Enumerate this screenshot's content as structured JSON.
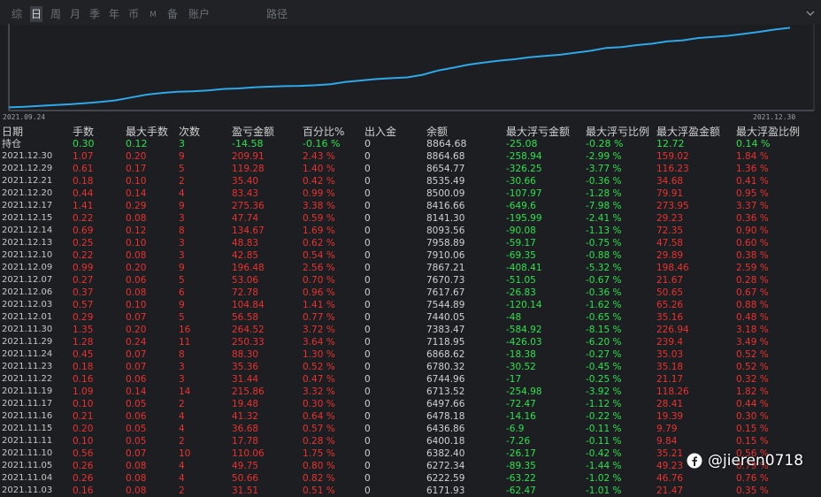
{
  "tabs": [
    {
      "label": "综",
      "active": false
    },
    {
      "label": "日",
      "active": true
    },
    {
      "label": "周",
      "active": false
    },
    {
      "label": "月",
      "active": false
    },
    {
      "label": "季",
      "active": false
    },
    {
      "label": "年",
      "active": false
    },
    {
      "label": "币",
      "active": false
    },
    {
      "label": "M",
      "active": false
    },
    {
      "label": "备",
      "active": false
    },
    {
      "label": "账户",
      "active": false
    },
    {
      "label": "路径",
      "active": false
    }
  ],
  "chart_data": {
    "type": "line",
    "x_start_label": "2021.09.24",
    "x_end_label": "2021.12.30",
    "ylim": [
      6000,
      9000
    ],
    "series": [
      {
        "color": "#2ea8e8",
        "values": [
          6050,
          6070,
          6100,
          6130,
          6160,
          6200,
          6240,
          6300,
          6400,
          6500,
          6560,
          6600,
          6620,
          6650,
          6700,
          6720,
          6760,
          6780,
          6800,
          6810,
          6830,
          6870,
          6950,
          7000,
          7050,
          7080,
          7110,
          7200,
          7350,
          7450,
          7560,
          7630,
          7700,
          7750,
          7820,
          7870,
          7910,
          7980,
          8050,
          8150,
          8180,
          8250,
          8300,
          8380,
          8420,
          8500,
          8540,
          8580,
          8650,
          8720,
          8800,
          8864
        ]
      }
    ]
  },
  "table": {
    "headers": [
      "日期",
      "手数",
      "最大手数",
      "次数",
      "盈亏金额",
      "百分比%",
      "出入金",
      "余额",
      "最大浮亏金额",
      "最大浮亏比例",
      "最大浮盈金额",
      "最大浮盈比例"
    ],
    "position_row": [
      "持仓",
      "0.30",
      "0.12",
      "3",
      "-14.58",
      "-0.16 %",
      "0",
      "8864.68",
      "-25.08",
      "-0.28 %",
      "12.72",
      "0.14 %"
    ],
    "rows": [
      [
        "2021.12.30",
        "1.07",
        "0.20",
        "9",
        "209.91",
        "2.43 %",
        "0",
        "8864.68",
        "-258.94",
        "-2.99 %",
        "159.02",
        "1.84 %"
      ],
      [
        "2021.12.29",
        "0.61",
        "0.17",
        "5",
        "119.28",
        "1.40 %",
        "0",
        "8654.77",
        "-326.25",
        "-3.77 %",
        "116.23",
        "1.36 %"
      ],
      [
        "2021.12.21",
        "0.18",
        "0.10",
        "2",
        "35.40",
        "0.42 %",
        "0",
        "8535.49",
        "-30.66",
        "-0.36 %",
        "34.68",
        "0.41 %"
      ],
      [
        "2021.12.20",
        "0.44",
        "0.14",
        "4",
        "83.43",
        "0.99 %",
        "0",
        "8500.09",
        "-107.97",
        "-1.28 %",
        "79.91",
        "0.95 %"
      ],
      [
        "2021.12.17",
        "1.41",
        "0.29",
        "9",
        "275.36",
        "3.38 %",
        "0",
        "8416.66",
        "-649.6",
        "-7.98 %",
        "273.95",
        "3.37 %"
      ],
      [
        "2021.12.15",
        "0.22",
        "0.08",
        "3",
        "47.74",
        "0.59 %",
        "0",
        "8141.30",
        "-195.99",
        "-2.41 %",
        "29.23",
        "0.36 %"
      ],
      [
        "2021.12.14",
        "0.69",
        "0.12",
        "8",
        "134.67",
        "1.69 %",
        "0",
        "8093.56",
        "-90.08",
        "-1.13 %",
        "72.35",
        "0.90 %"
      ],
      [
        "2021.12.13",
        "0.25",
        "0.10",
        "3",
        "48.83",
        "0.62 %",
        "0",
        "7958.89",
        "-59.17",
        "-0.75 %",
        "47.58",
        "0.60 %"
      ],
      [
        "2021.12.10",
        "0.22",
        "0.08",
        "3",
        "42.85",
        "0.54 %",
        "0",
        "7910.06",
        "-69.35",
        "-0.88 %",
        "29.89",
        "0.38 %"
      ],
      [
        "2021.12.09",
        "0.99",
        "0.20",
        "9",
        "196.48",
        "2.56 %",
        "0",
        "7867.21",
        "-408.41",
        "-5.32 %",
        "198.46",
        "2.59 %"
      ],
      [
        "2021.12.07",
        "0.27",
        "0.06",
        "5",
        "53.06",
        "0.70 %",
        "0",
        "7670.73",
        "-51.05",
        "-0.67 %",
        "21.67",
        "0.28 %"
      ],
      [
        "2021.12.06",
        "0.37",
        "0.08",
        "6",
        "72.78",
        "0.96 %",
        "0",
        "7617.67",
        "-26.83",
        "-0.36 %",
        "50.65",
        "0.67 %"
      ],
      [
        "2021.12.03",
        "0.57",
        "0.10",
        "9",
        "104.84",
        "1.41 %",
        "0",
        "7544.89",
        "-120.14",
        "-1.62 %",
        "65.26",
        "0.88 %"
      ],
      [
        "2021.12.01",
        "0.29",
        "0.07",
        "5",
        "56.58",
        "0.77 %",
        "0",
        "7440.05",
        "-48",
        "-0.65 %",
        "35.16",
        "0.48 %"
      ],
      [
        "2021.11.30",
        "1.35",
        "0.20",
        "16",
        "264.52",
        "3.72 %",
        "0",
        "7383.47",
        "-584.92",
        "-8.15 %",
        "226.94",
        "3.18 %"
      ],
      [
        "2021.11.29",
        "1.28",
        "0.24",
        "11",
        "250.33",
        "3.64 %",
        "0",
        "7118.95",
        "-426.03",
        "-6.20 %",
        "239.4",
        "3.49 %"
      ],
      [
        "2021.11.24",
        "0.45",
        "0.07",
        "8",
        "88.30",
        "1.30 %",
        "0",
        "6868.62",
        "-18.38",
        "-0.27 %",
        "35.03",
        "0.52 %"
      ],
      [
        "2021.11.23",
        "0.18",
        "0.07",
        "3",
        "35.36",
        "0.52 %",
        "0",
        "6780.32",
        "-30.52",
        "-0.45 %",
        "35.18",
        "0.52 %"
      ],
      [
        "2021.11.22",
        "0.16",
        "0.06",
        "3",
        "31.44",
        "0.47 %",
        "0",
        "6744.96",
        "-17",
        "-0.25 %",
        "21.17",
        "0.32 %"
      ],
      [
        "2021.11.19",
        "1.09",
        "0.14",
        "14",
        "215.86",
        "3.32 %",
        "0",
        "6713.52",
        "-254.98",
        "-3.92 %",
        "118.26",
        "1.82 %"
      ],
      [
        "2021.11.17",
        "0.10",
        "0.05",
        "2",
        "19.48",
        "0.30 %",
        "0",
        "6497.66",
        "-72.47",
        "-1.12 %",
        "28.41",
        "0.44 %"
      ],
      [
        "2021.11.16",
        "0.21",
        "0.06",
        "4",
        "41.32",
        "0.64 %",
        "0",
        "6478.18",
        "-14.16",
        "-0.22 %",
        "19.39",
        "0.30 %"
      ],
      [
        "2021.11.15",
        "0.20",
        "0.05",
        "4",
        "36.68",
        "0.57 %",
        "0",
        "6436.86",
        "-6.9",
        "-0.11 %",
        "9.79",
        "0.15 %"
      ],
      [
        "2021.11.11",
        "0.10",
        "0.05",
        "2",
        "17.78",
        "0.28 %",
        "0",
        "6400.18",
        "-7.26",
        "-0.11 %",
        "9.84",
        "0.15 %"
      ],
      [
        "2021.11.10",
        "0.56",
        "0.07",
        "10",
        "110.06",
        "1.75 %",
        "0",
        "6382.40",
        "-26.17",
        "-0.42 %",
        "35.21",
        "0.56 %"
      ],
      [
        "2021.11.05",
        "0.26",
        "0.08",
        "4",
        "49.75",
        "0.80 %",
        "0",
        "6272.34",
        "-89.35",
        "-1.44 %",
        "49.23",
        "0.79 %"
      ],
      [
        "2021.11.04",
        "0.26",
        "0.08",
        "4",
        "50.66",
        "0.82 %",
        "0",
        "6222.59",
        "-63.22",
        "-1.02 %",
        "46.76",
        "0.76 %"
      ],
      [
        "2021.11.03",
        "0.16",
        "0.08",
        "2",
        "31.51",
        "0.51 %",
        "0",
        "6171.93",
        "-62.47",
        "-1.01 %",
        "21.47",
        "0.35 %"
      ]
    ]
  },
  "watermark": {
    "text": "@jieren0718",
    "icon": "facebook-icon"
  },
  "colors": {
    "positive": "#e8332f",
    "negative": "#2fe04f",
    "line": "#2ea8e8",
    "background": "#1c1e22"
  }
}
